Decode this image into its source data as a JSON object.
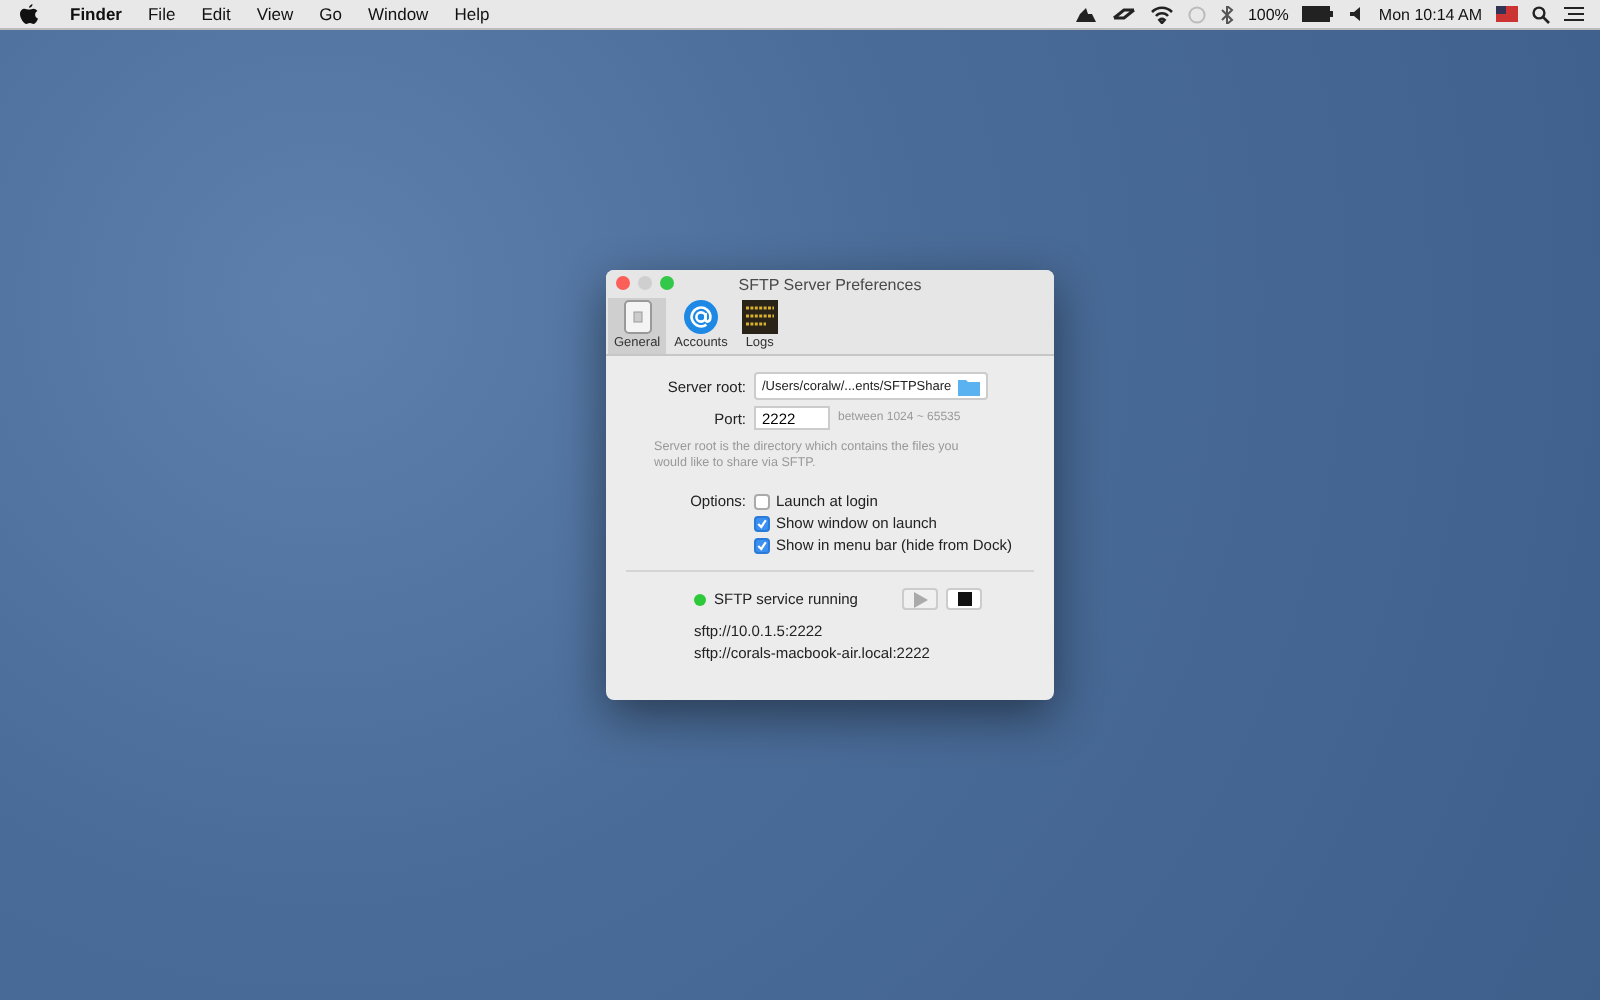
{
  "menu_bar": {
    "menus": [
      {
        "label": "Finder",
        "kind": "app"
      },
      {
        "label": "File",
        "kind": "menu"
      },
      {
        "label": "Edit",
        "kind": "menu"
      },
      {
        "label": "View",
        "kind": "menu"
      },
      {
        "label": "Go",
        "kind": "menu"
      },
      {
        "label": "Window",
        "kind": "menu"
      },
      {
        "label": "Help",
        "kind": "menu"
      }
    ],
    "battery": "100%",
    "clock": "Mon 10:14 AM"
  },
  "window": {
    "title": "SFTP Server Preferences",
    "toolbar": [
      {
        "label": "General",
        "kind": "general",
        "selected": true
      },
      {
        "label": "Accounts",
        "kind": "accounts",
        "selected": false
      },
      {
        "label": "Logs",
        "kind": "logs",
        "selected": false
      }
    ],
    "server_root": {
      "label": "Server root:",
      "value": "/Users/coralw/...ents/SFTPShare"
    },
    "port": {
      "label": "Port:",
      "value": "2222",
      "hint": "between 1024 ~ 65535"
    },
    "description": "Server root is the directory which contains the files you would like to share via SFTP.",
    "options_label": "Options:",
    "options": [
      {
        "label": "Launch at login",
        "checked": false
      },
      {
        "label": "Show window on launch",
        "checked": true
      },
      {
        "label": "Show in menu bar (hide from Dock)",
        "checked": true
      }
    ],
    "service": {
      "status": "SFTP service running",
      "color": "#2ec93a",
      "play_disabled": true,
      "stop_disabled": false
    },
    "urls": [
      "sftp://10.0.1.5:2222",
      "sftp://corals-macbook-air.local:2222"
    ]
  }
}
